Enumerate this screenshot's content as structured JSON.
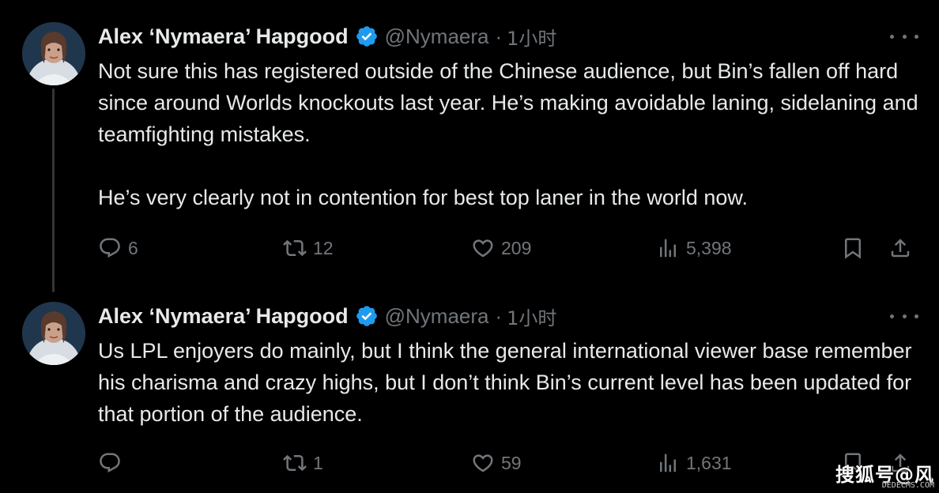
{
  "thread": [
    {
      "author": {
        "display_name": "Alex ‘Nymaera’ Hapgood",
        "handle": "@Nymaera",
        "verified": true,
        "avatar_icon": "avatar-photo"
      },
      "separator": "·",
      "time": "1小时",
      "body": [
        "Not sure this has registered outside of the Chinese audience, but Bin’s fallen off hard since around Worlds knockouts last year. He’s making avoidable laning, sidelaning and teamfighting mistakes.",
        "He’s very clearly not in contention for best top laner in the world now."
      ],
      "metrics": {
        "replies": "6",
        "retweets": "12",
        "likes": "209",
        "views": "5,398"
      }
    },
    {
      "author": {
        "display_name": "Alex ‘Nymaera’ Hapgood",
        "handle": "@Nymaera",
        "verified": true,
        "avatar_icon": "avatar-photo"
      },
      "separator": "·",
      "time": "1小时",
      "body": [
        "Us LPL enjoyers do mainly, but I think the general international viewer base remember his charisma and crazy highs, but I don’t think Bin’s current level has been updated for that portion of the audience."
      ],
      "metrics": {
        "replies": "",
        "retweets": "1",
        "likes": "59",
        "views": "1,631"
      }
    }
  ],
  "watermark": {
    "text": "搜狐号@风",
    "subtext": "DEDECMS.COM"
  },
  "icons": {
    "reply": "reply-icon",
    "retweet": "retweet-icon",
    "like": "heart-icon",
    "views": "views-icon",
    "bookmark": "bookmark-icon",
    "share": "share-icon",
    "more": "more-icon",
    "verified": "verified-badge-icon"
  },
  "colors": {
    "background": "#000000",
    "text": "#e7e9ea",
    "muted": "#71767b",
    "verified": "#1d9bf0",
    "thread_line": "#333639"
  }
}
